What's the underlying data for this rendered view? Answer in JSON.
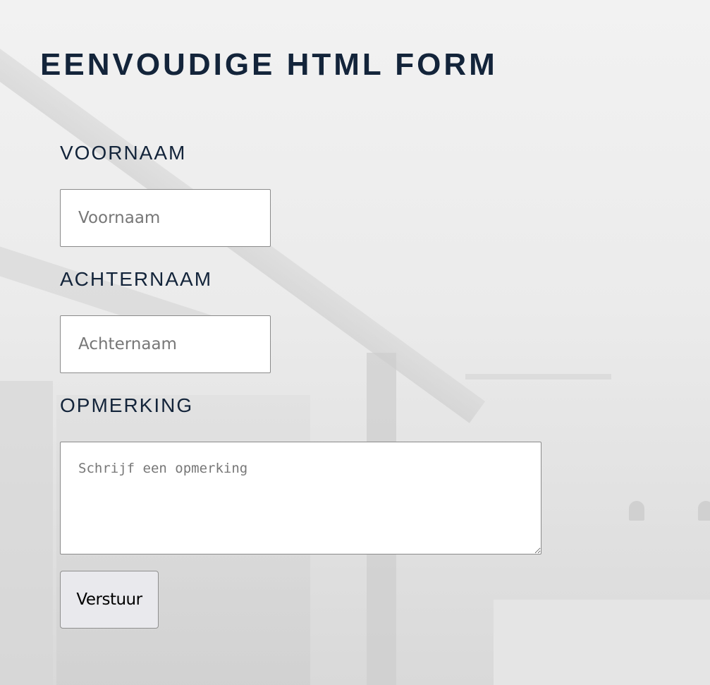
{
  "page": {
    "title": "EENVOUDIGE HTML FORM"
  },
  "form": {
    "first_name": {
      "label": "VOORNAAM",
      "placeholder": "Voornaam",
      "value": ""
    },
    "last_name": {
      "label": "ACHTERNAAM",
      "placeholder": "Achternaam",
      "value": ""
    },
    "comment": {
      "label": "OPMERKING",
      "placeholder": "Schrijf een opmerking",
      "value": ""
    },
    "submit_label": "Verstuur"
  },
  "theme": {
    "heading_color": "#13243a",
    "field_border": "#8a8a8a",
    "button_bg": "#e9e9ed"
  }
}
